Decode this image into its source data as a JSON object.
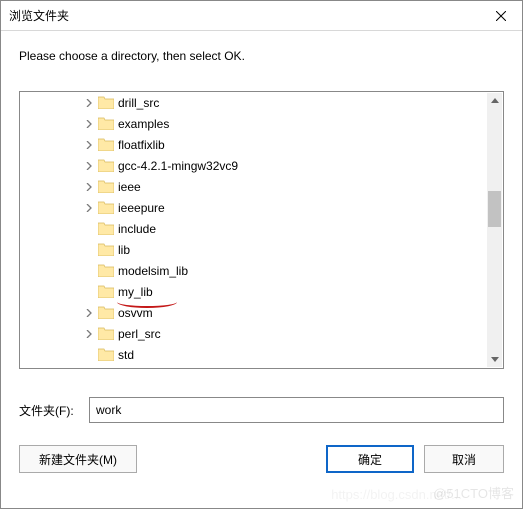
{
  "dialog": {
    "title": "浏览文件夹",
    "instruction": "Please choose a directory, then select OK."
  },
  "tree": {
    "items": [
      {
        "label": "drill_src",
        "expandable": true
      },
      {
        "label": "examples",
        "expandable": true
      },
      {
        "label": "floatfixlib",
        "expandable": true
      },
      {
        "label": "gcc-4.2.1-mingw32vc9",
        "expandable": true
      },
      {
        "label": "ieee",
        "expandable": true
      },
      {
        "label": "ieeepure",
        "expandable": true
      },
      {
        "label": "include",
        "expandable": false
      },
      {
        "label": "lib",
        "expandable": false
      },
      {
        "label": "modelsim_lib",
        "expandable": false
      },
      {
        "label": "my_lib",
        "expandable": false
      },
      {
        "label": "osvvm",
        "expandable": true
      },
      {
        "label": "perl_src",
        "expandable": true
      },
      {
        "label": "std",
        "expandable": false
      }
    ]
  },
  "field": {
    "label": "文件夹(F):",
    "value": "work"
  },
  "buttons": {
    "new_folder": "新建文件夹(M)",
    "ok": "确定",
    "cancel": "取消"
  },
  "watermark": "@51CTO博客"
}
